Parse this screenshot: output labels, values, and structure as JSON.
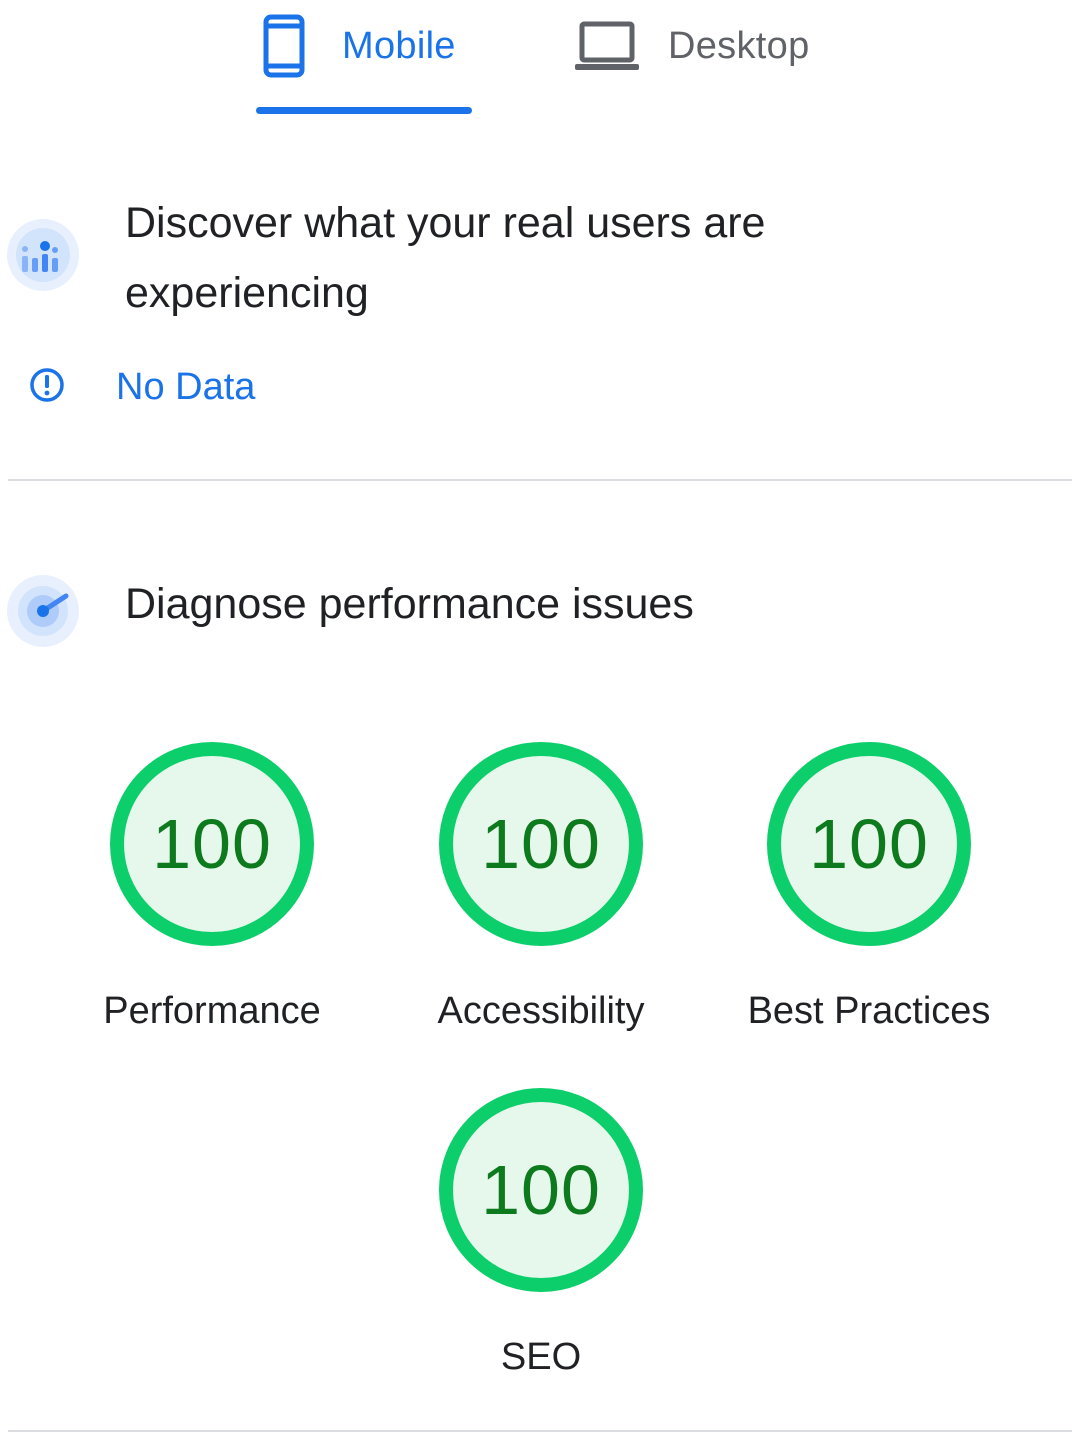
{
  "tabs": {
    "mobile": {
      "label": "Mobile",
      "selected": true,
      "icon": "smartphone-icon"
    },
    "desktop": {
      "label": "Desktop",
      "selected": false,
      "icon": "laptop-icon"
    }
  },
  "field_data": {
    "title": "Discover what your real users are experiencing",
    "icon": "crux-chart-icon",
    "status_icon": "info-circle-icon",
    "status_label": "No Data"
  },
  "lab_data": {
    "title": "Diagnose performance issues",
    "icon": "lighthouse-gauge-icon",
    "scores": [
      {
        "label": "Performance",
        "value": "100",
        "fraction": 1.0
      },
      {
        "label": "Accessibility",
        "value": "100",
        "fraction": 1.0
      },
      {
        "label": "Best Practices",
        "value": "100",
        "fraction": 1.0
      },
      {
        "label": "SEO",
        "value": "100",
        "fraction": 1.0
      }
    ]
  },
  "colors": {
    "accent": "#1a73e8",
    "pass_ring": "#0cce6b",
    "pass_fill": "#e6f7ec",
    "pass_text": "#0d7a1e",
    "divider": "#dadce0"
  }
}
